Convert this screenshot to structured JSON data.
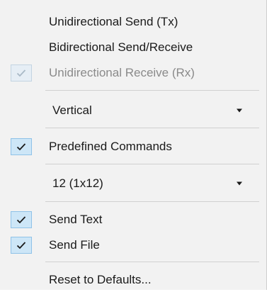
{
  "menu": {
    "items": [
      {
        "label": "Unidirectional Send (Tx)",
        "checked": false,
        "enabled": true
      },
      {
        "label": "Bidirectional Send/Receive",
        "checked": false,
        "enabled": true
      },
      {
        "label": "Unidirectional Receive (Rx)",
        "checked": true,
        "enabled": false
      },
      {
        "label": "Vertical",
        "type": "dropdown"
      },
      {
        "label": "Predefined Commands",
        "checked": true,
        "enabled": true
      },
      {
        "label": "12 (1x12)",
        "type": "dropdown"
      },
      {
        "label": "Send Text",
        "checked": true,
        "enabled": true
      },
      {
        "label": "Send File",
        "checked": true,
        "enabled": true
      },
      {
        "label": "Reset to Defaults...",
        "checked": false,
        "enabled": true
      }
    ]
  },
  "icons": {
    "check": "checkmark-icon",
    "dropdown": "chevron-down-icon"
  },
  "colors": {
    "menu_bg": "#f2f2f2",
    "check_bg": "#cde6f7",
    "check_border": "#8fc2e8",
    "disabled_text": "#8a8a8a"
  }
}
